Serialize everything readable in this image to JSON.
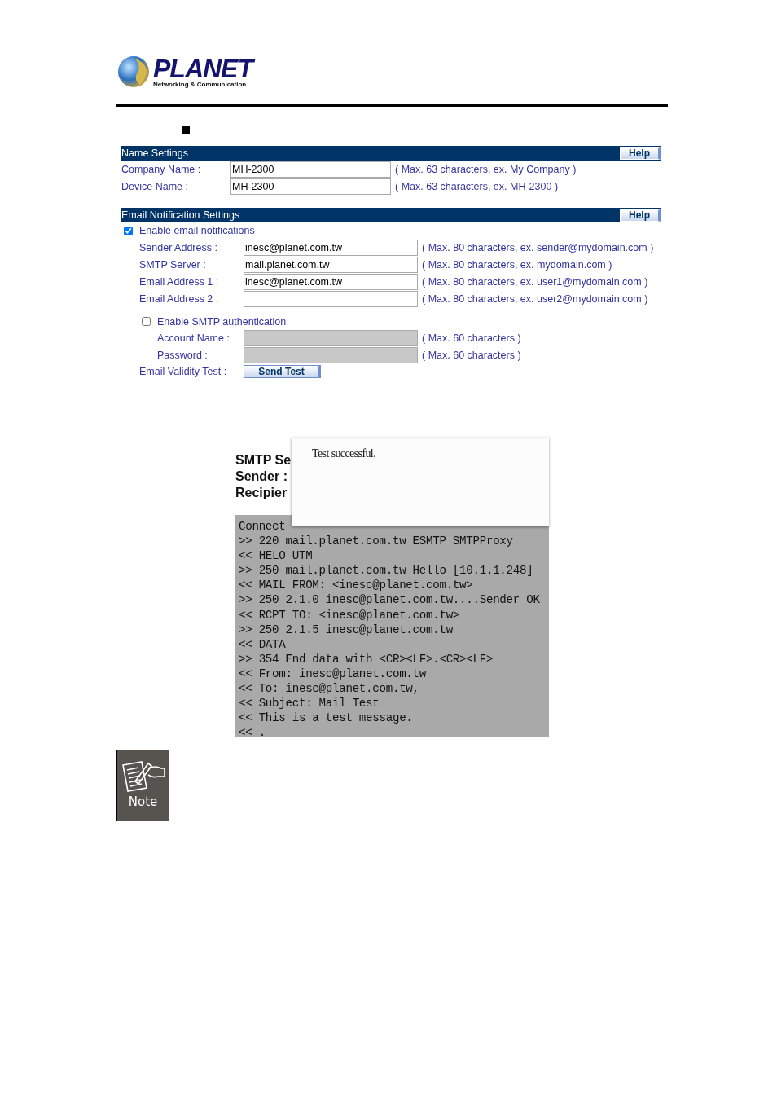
{
  "header": {
    "brand": "PLANET",
    "tagline": "Networking & Communication"
  },
  "sections": [
    {
      "title": "Name Settings",
      "help": "Help",
      "rows": [
        {
          "kind": "text",
          "label": "Company Name :",
          "value": "MH-2300",
          "hint": "( Max. 63 characters, ex. My Company )"
        },
        {
          "kind": "text",
          "label": "Device Name :",
          "value": "MH-2300",
          "hint": "( Max. 63 characters, ex. MH-2300 )"
        }
      ]
    },
    {
      "title": "Email Notification Settings",
      "help": "Help",
      "rows": [
        {
          "kind": "checkbox",
          "label": "Enable email notifications",
          "checked": true,
          "children": [
            {
              "kind": "text",
              "label": "Sender Address :",
              "value": "inesc@planet.com.tw",
              "hint": "( Max. 80 characters, ex. sender@mydomain.com )"
            },
            {
              "kind": "text",
              "label": "SMTP Server :",
              "value": "mail.planet.com.tw",
              "hint": "( Max. 80 characters, ex. mydomain.com )"
            },
            {
              "kind": "text",
              "label": "Email Address 1 :",
              "value": "inesc@planet.com.tw",
              "hint": "( Max. 80 characters, ex. user1@mydomain.com )"
            },
            {
              "kind": "text",
              "label": "Email Address 2 :",
              "hint": "( Max. 80 characters, ex. user2@mydomain.com )"
            },
            {
              "kind": "checkbox",
              "label": "Enable SMTP authentication",
              "checked": false,
              "children": [
                {
                  "kind": "text",
                  "label": "Account Name :",
                  "disabled": true,
                  "hint": "( Max. 60 characters )"
                },
                {
                  "kind": "text",
                  "label": "Password :",
                  "disabled": true,
                  "hint": "( Max. 60 characters )"
                }
              ]
            },
            {
              "kind": "button",
              "label": "Email Validity Test :",
              "button": "Send Test"
            }
          ]
        }
      ]
    }
  ],
  "test_result": {
    "header_lines": [
      "SMTP Se",
      "Sender :",
      "Recipier"
    ],
    "log": [
      "Connect",
      ">> 220 mail.planet.com.tw ESMTP SMTPProxy",
      "<< HELO UTM",
      ">> 250 mail.planet.com.tw Hello [10.1.1.248]",
      "<< MAIL FROM: <inesc@planet.com.tw>",
      ">> 250 2.1.0 inesc@planet.com.tw....Sender OK",
      "<< RCPT TO: <inesc@planet.com.tw>",
      ">> 250 2.1.5 inesc@planet.com.tw",
      "<< DATA",
      ">> 354 End data with <CR><LF>.<CR><LF>",
      "<< From: inesc@planet.com.tw",
      "<< To: inesc@planet.com.tw,",
      "<< Subject: Mail Test",
      "<< This is a test message.",
      "<< ."
    ],
    "popup": {
      "message": "Test successful."
    }
  },
  "note": {
    "label": "Note"
  }
}
